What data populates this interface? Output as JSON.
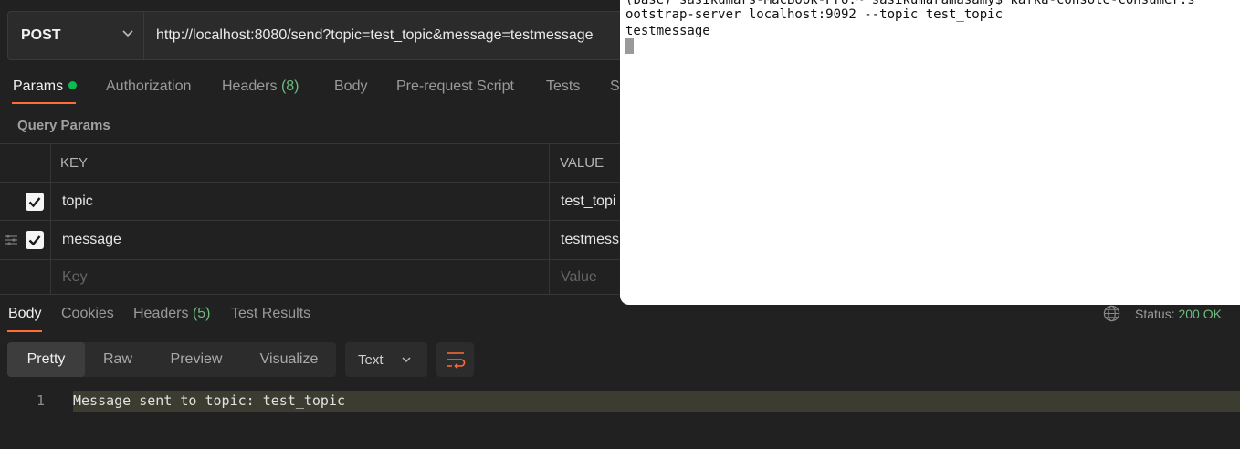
{
  "request": {
    "method": "POST",
    "url": "http://localhost:8080/send?topic=test_topic&message=testmessage"
  },
  "request_tabs": {
    "params": "Params",
    "authorization": "Authorization",
    "headers": "Headers",
    "headers_count": "(8)",
    "body": "Body",
    "prerequest": "Pre-request Script",
    "tests": "Tests",
    "settings_partial": "S"
  },
  "query_params": {
    "title": "Query Params",
    "key_header": "KEY",
    "value_header": "VALUE",
    "rows": [
      {
        "key": "topic",
        "value": "test_topi",
        "checked": true
      },
      {
        "key": "message",
        "value": "testmess",
        "checked": true
      }
    ],
    "new_key_placeholder": "Key",
    "new_value_placeholder": "Value"
  },
  "response_tabs": {
    "body": "Body",
    "cookies": "Cookies",
    "headers": "Headers",
    "headers_count": "(5)",
    "test_results": "Test Results"
  },
  "status": {
    "label": "Status:",
    "value": "200 OK"
  },
  "view_modes": [
    "Pretty",
    "Raw",
    "Preview",
    "Visualize"
  ],
  "format": "Text",
  "response_body": {
    "line_number": "1",
    "text": "Message sent to topic: test_topic"
  },
  "terminal": {
    "lines": [
      "(base) sasikumars-MacBook-Pro:~ sasikumaramasamy$ kafka-console-consumer.s",
      "ootstrap-server localhost:9092 --topic test_topic",
      "testmessage"
    ]
  },
  "colors": {
    "accent": "#ff6c37",
    "success": "#0cbb52",
    "status_ok": "#6dbb7f"
  }
}
